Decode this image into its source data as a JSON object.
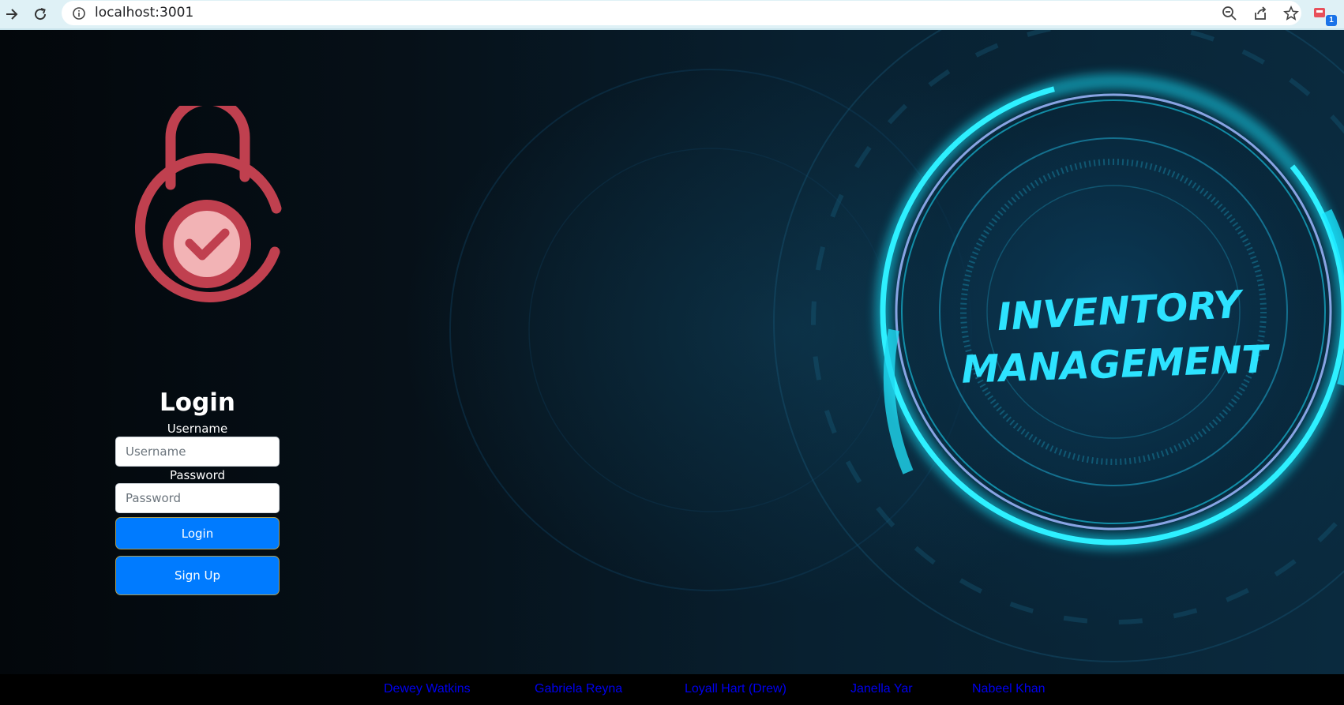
{
  "browser": {
    "url": "localhost:3001",
    "extension_badge": "1",
    "icons": [
      "forward-arrow-icon",
      "reload-icon",
      "info-icon",
      "zoom-out-icon",
      "share-icon",
      "star-icon",
      "extension-icon"
    ]
  },
  "hero": {
    "line1": "INVENTORY",
    "line2": "MANAGEMENT",
    "colors": {
      "ring": "#19e6ff",
      "text": "#2de3ff",
      "lock": "#c0404f",
      "lock_inner": "#f2b3b5"
    }
  },
  "login": {
    "title": "Login",
    "username_label": "Username",
    "username_placeholder": "Username",
    "username_value": "",
    "password_label": "Password",
    "password_placeholder": "Password",
    "password_value": "",
    "login_button": "Login",
    "signup_button": "Sign Up",
    "button_color": "#007bff"
  },
  "footer": {
    "links": [
      "Dewey Watkins",
      "Gabriela Reyna",
      "Loyall Hart (Drew)",
      "Janella Yar",
      "Nabeel Khan"
    ],
    "link_color": "#0000ee"
  }
}
